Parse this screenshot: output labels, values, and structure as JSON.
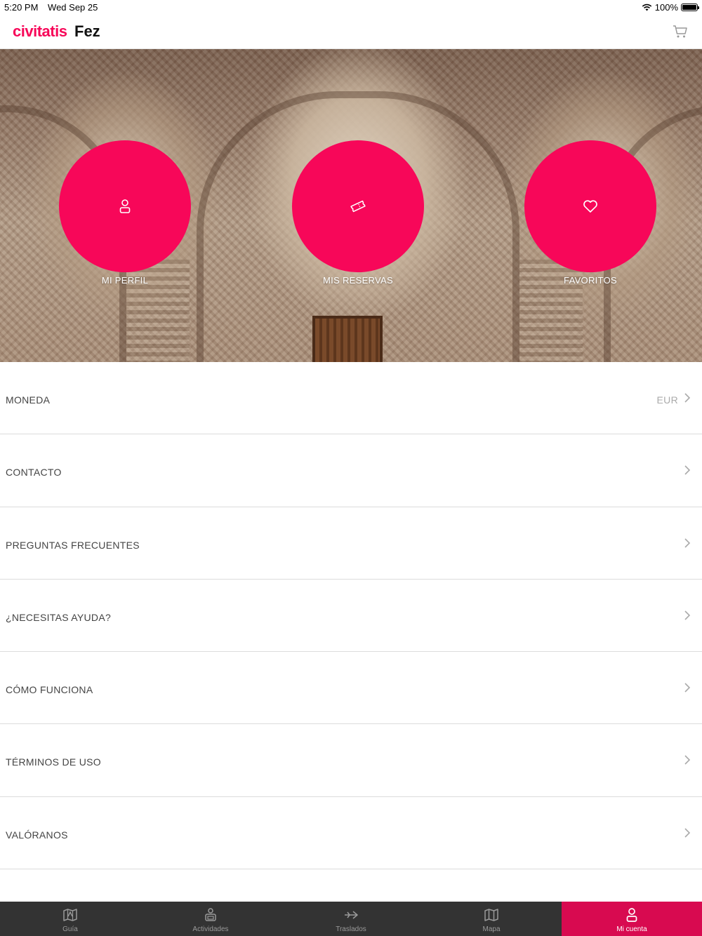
{
  "status_bar": {
    "time": "5:20 PM",
    "date": "Wed Sep 25",
    "battery": "100%"
  },
  "header": {
    "brand": "civitatis",
    "city": "Fez"
  },
  "hero": {
    "buttons": [
      {
        "label": "MI PERFIL",
        "icon": "user-icon"
      },
      {
        "label": "MIS RESERVAS",
        "icon": "ticket-icon"
      },
      {
        "label": "FAVORITOS",
        "icon": "heart-icon"
      }
    ]
  },
  "menu": {
    "items": [
      {
        "label": "MONEDA",
        "value": "EUR"
      },
      {
        "label": "CONTACTO"
      },
      {
        "label": "PREGUNTAS FRECUENTES"
      },
      {
        "label": "¿NECESITAS AYUDA?"
      },
      {
        "label": "CÓMO FUNCIONA"
      },
      {
        "label": "TÉRMINOS DE USO"
      },
      {
        "label": "VALÓRANOS"
      }
    ]
  },
  "tabbar": {
    "tabs": [
      {
        "label": "Guía",
        "icon": "map-guide-icon"
      },
      {
        "label": "Actividades",
        "icon": "activities-icon"
      },
      {
        "label": "Traslados",
        "icon": "transfer-plane-icon"
      },
      {
        "label": "Mapa",
        "icon": "map-icon"
      },
      {
        "label": "Mi cuenta",
        "icon": "account-icon",
        "active": true
      }
    ]
  },
  "colors": {
    "brand": "#f70759",
    "tab_active": "#d80a50",
    "tabbar_bg": "#333333"
  }
}
